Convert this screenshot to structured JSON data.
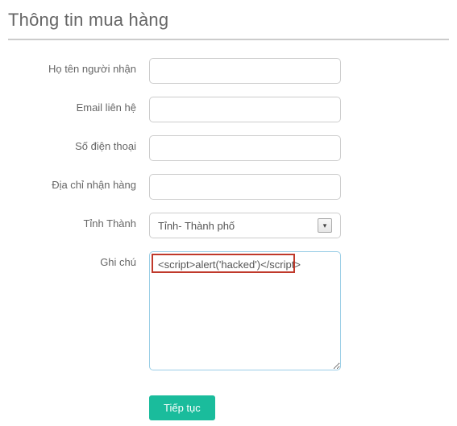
{
  "title": "Thông tin mua hàng",
  "form": {
    "name_label": "Họ tên người nhận",
    "name_value": "",
    "email_label": "Email liên hệ",
    "email_value": "",
    "phone_label": "Số điện thoại",
    "phone_value": "",
    "address_label": "Địa chỉ nhận hàng",
    "address_value": "",
    "province_label": "Tỉnh Thành",
    "province_selected": "Tỉnh- Thành phố",
    "note_label": "Ghi chú",
    "note_value": "<script>alert('hacked')</script>",
    "submit_label": "Tiếp tục"
  }
}
